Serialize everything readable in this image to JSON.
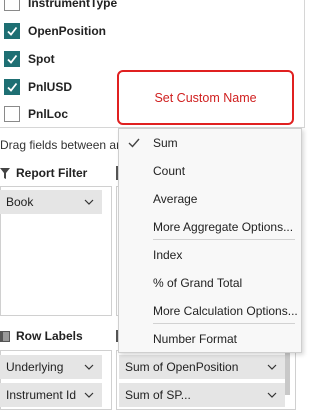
{
  "fields": [
    {
      "label": "InstrumentType",
      "checked": false
    },
    {
      "label": "OpenPosition",
      "checked": true
    },
    {
      "label": "Spot",
      "checked": true
    },
    {
      "label": "PnlUSD",
      "checked": true
    },
    {
      "label": "PnlLoc",
      "checked": false
    }
  ],
  "drag_hint": "Drag fields between are",
  "report_filter": {
    "title": "Report Filter",
    "item": "Book"
  },
  "row_labels": {
    "title": "Row Labels",
    "items": [
      "Underlying",
      "Instrument Id"
    ]
  },
  "values_area": {
    "items": [
      "Sum of OpenPosition",
      "Sum of SP..."
    ]
  },
  "custom_name": "Set Custom Name",
  "menu": {
    "group1": [
      "Sum",
      "Count",
      "Average",
      "More Aggregate Options..."
    ],
    "group2": [
      "Index",
      "% of Grand Total",
      "More Calculation Options..."
    ],
    "group3": [
      "Number Format"
    ],
    "checked_item": "Sum"
  },
  "colors": {
    "checkbox": "#1e6f73",
    "annotation": "#e02020"
  }
}
